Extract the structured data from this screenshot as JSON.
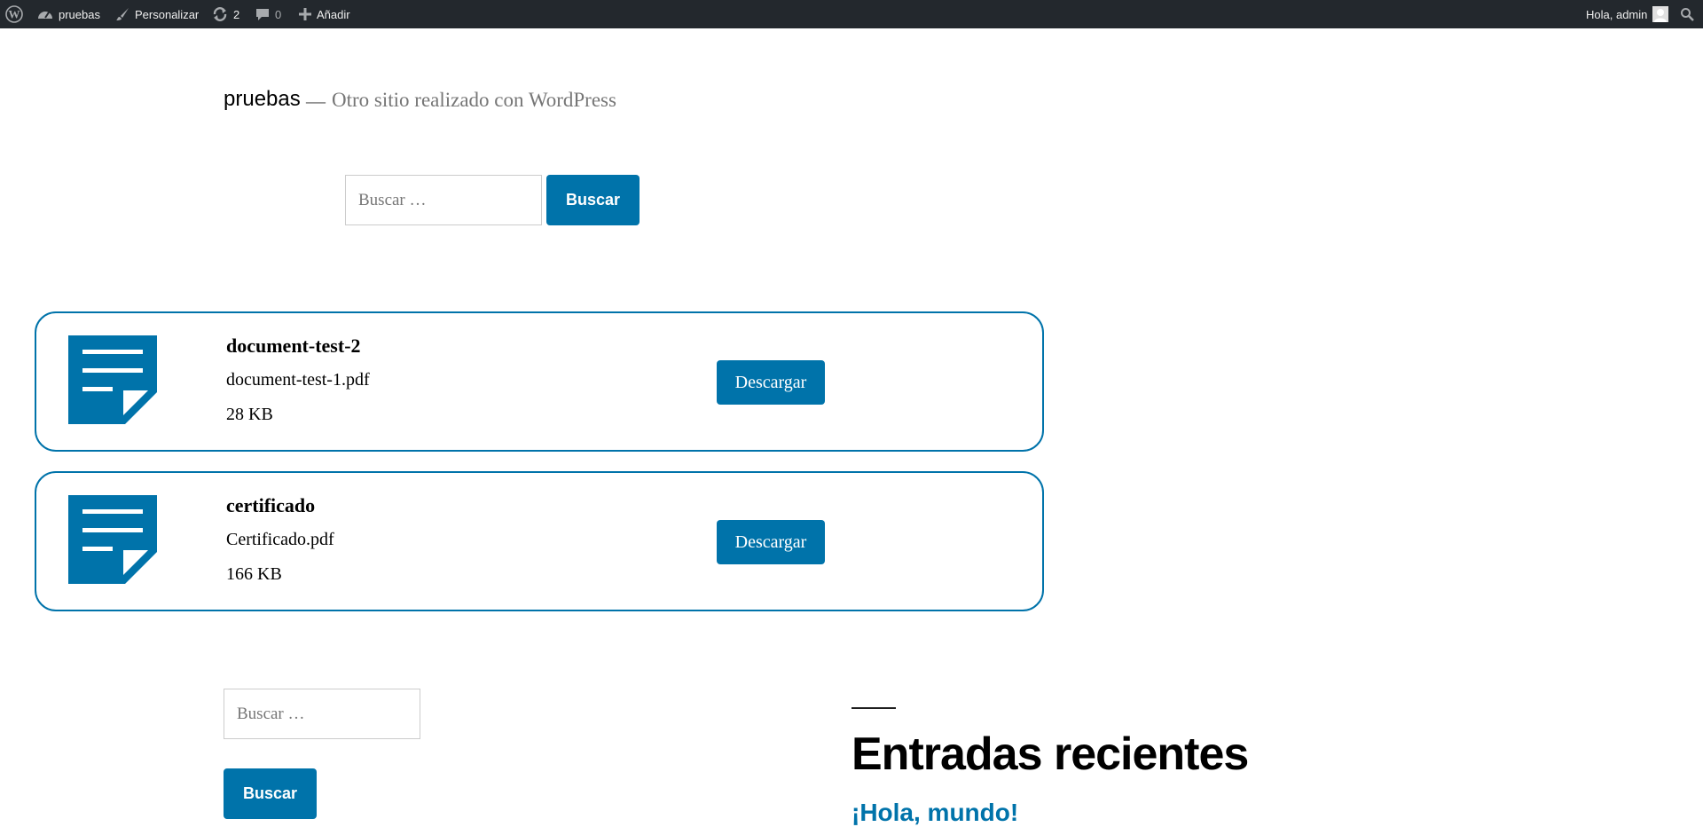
{
  "admin_bar": {
    "site_name": "pruebas",
    "customize_label": "Personalizar",
    "updates_count": "2",
    "comments_count": "0",
    "new_label": "Añadir",
    "greeting": "Hola, admin"
  },
  "site": {
    "title": "pruebas",
    "separator": "—",
    "description": "Otro sitio realizado con WordPress"
  },
  "header_search": {
    "placeholder": "Buscar …",
    "button_label": "Buscar"
  },
  "documents": [
    {
      "title": "document-test-2",
      "filename": "document-test-1.pdf",
      "size": "28 KB",
      "button_label": "Descargar"
    },
    {
      "title": "certificado",
      "filename": "Certificado.pdf",
      "size": "166 KB",
      "button_label": "Descargar"
    }
  ],
  "footer_search": {
    "placeholder": "Buscar …",
    "button_label": "Buscar"
  },
  "recent_posts": {
    "title": "Entradas recientes",
    "items": [
      "¡Hola, mundo!"
    ]
  },
  "colors": {
    "accent": "#0073aa",
    "admin_bar_bg": "#23282d"
  },
  "icons": [
    "wordpress-icon",
    "dashboard-icon",
    "brush-icon",
    "updates-icon",
    "comment-icon",
    "plus-icon",
    "avatar-icon",
    "search-icon",
    "document-icon"
  ]
}
